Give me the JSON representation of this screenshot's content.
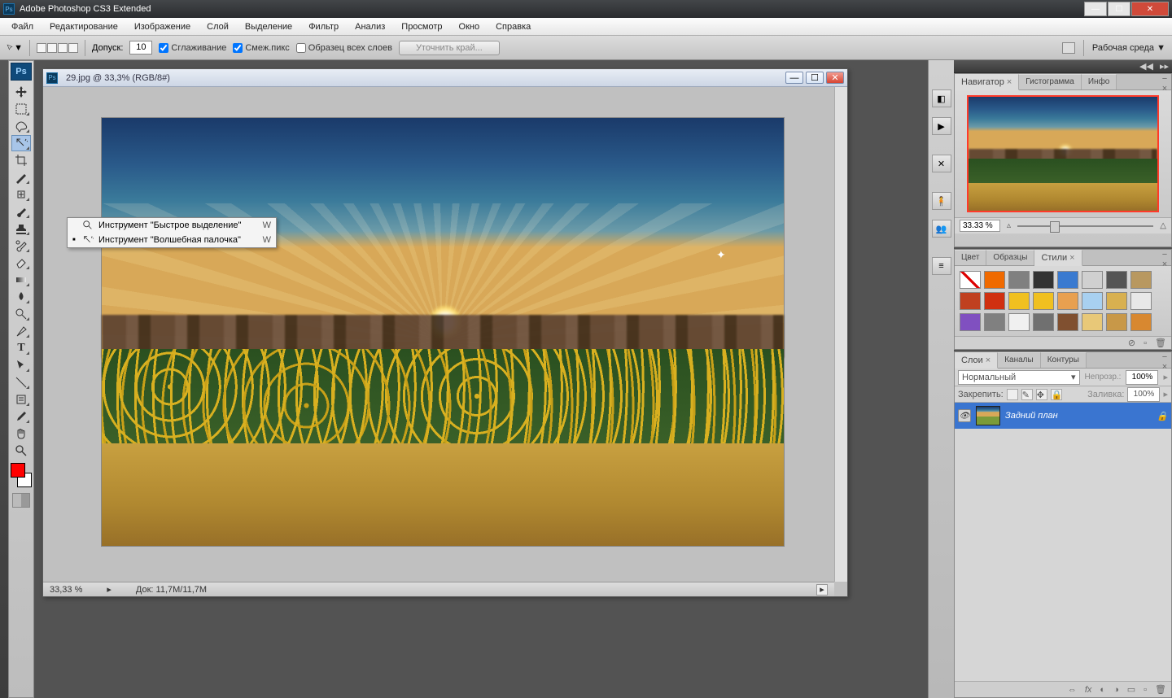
{
  "app": {
    "title": "Adobe Photoshop CS3 Extended"
  },
  "menu": [
    "Файл",
    "Редактирование",
    "Изображение",
    "Слой",
    "Выделение",
    "Фильтр",
    "Анализ",
    "Просмотр",
    "Окно",
    "Справка"
  ],
  "options": {
    "tolerance_label": "Допуск:",
    "tolerance_value": "10",
    "antialias": "Сглаживание",
    "contiguous": "Смеж.пикс",
    "all_layers": "Образец всех слоев",
    "refine": "Уточнить край...",
    "workspace": "Рабочая среда ▼"
  },
  "flyout": {
    "items": [
      {
        "bullet": "",
        "label": "Инструмент \"Быстрое выделение\"",
        "key": "W"
      },
      {
        "bullet": "■",
        "label": "Инструмент \"Волшебная палочка\"",
        "key": "W"
      }
    ]
  },
  "doc": {
    "title": "29.jpg @ 33,3% (RGB/8#)",
    "zoom": "33,33 %",
    "docinfo": "Док: 11,7M/11,7M"
  },
  "navigator": {
    "tabs": [
      "Навигатор",
      "Гистограмма",
      "Инфо"
    ],
    "zoom": "33.33 %"
  },
  "styles": {
    "tabs": [
      "Цвет",
      "Образцы",
      "Стили"
    ],
    "swatches": [
      "#ffffff",
      "#f06a00",
      "#808080",
      "#333333",
      "#3a7ad0",
      "#d0d0d0",
      "#555555",
      "#b89860",
      "#c04020",
      "#d03010",
      "#f0c020",
      "#f0c020",
      "#e8a050",
      "#a8d0f0",
      "#d8b050",
      "#e8e8e8",
      "#8050c0",
      "#808080",
      "#f0f0f0",
      "#707070",
      "#805030",
      "#e8c878",
      "#c89848",
      "#d88830"
    ]
  },
  "layers": {
    "tabs": [
      "Слои",
      "Каналы",
      "Контуры"
    ],
    "blend": "Нормальный",
    "opacity_label": "Непрозр.:",
    "opacity": "100%",
    "lock_label": "Закрепить:",
    "fill_label": "Заливка:",
    "fill": "100%",
    "layer_name": "Задний план"
  }
}
